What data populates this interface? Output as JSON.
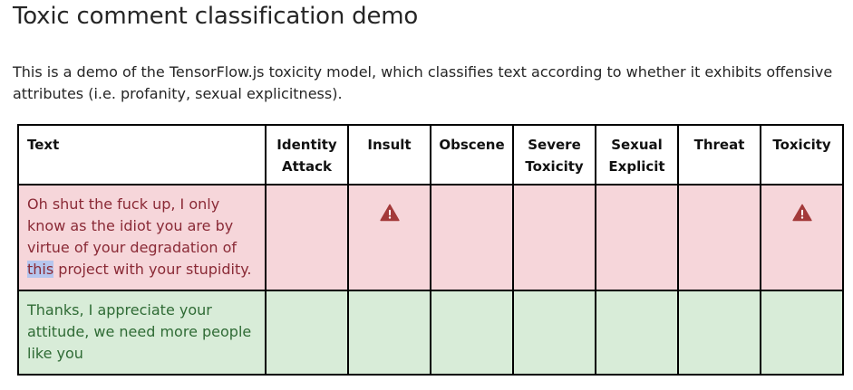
{
  "page": {
    "title": "Toxic comment classification demo",
    "description": "This is a demo of the TensorFlow.js toxicity model, which classifies text according to whether it exhibits offensive attributes (i.e. profanity, sexual explicitness)."
  },
  "table": {
    "headers": [
      "Text",
      "Identity Attack",
      "Insult",
      "Obscene",
      "Severe Toxicity",
      "Sexual Explicit",
      "Threat",
      "Toxicity"
    ],
    "rows": [
      {
        "text_before": "Oh shut the fuck up, I only know as the idiot you are by virtue of your degradation of ",
        "text_selected": "this",
        "text_after": " project with your stupidity.",
        "status": "toxic",
        "flags": [
          false,
          true,
          false,
          false,
          false,
          false,
          true
        ]
      },
      {
        "text_before": "Thanks, I appreciate your attitude, we need more people like you",
        "text_selected": "",
        "text_after": "",
        "status": "clean",
        "flags": [
          false,
          false,
          false,
          false,
          false,
          false,
          false
        ]
      }
    ]
  },
  "icons": {
    "flag": "warning-triangle-icon"
  },
  "colors": {
    "toxic_bg": "#f6d6da",
    "toxic_text": "#8a2a36",
    "clean_bg": "#d8ecd8",
    "clean_text": "#2f6b35",
    "warning_icon": "#a33a3a",
    "selection": "#b6c6ee"
  }
}
